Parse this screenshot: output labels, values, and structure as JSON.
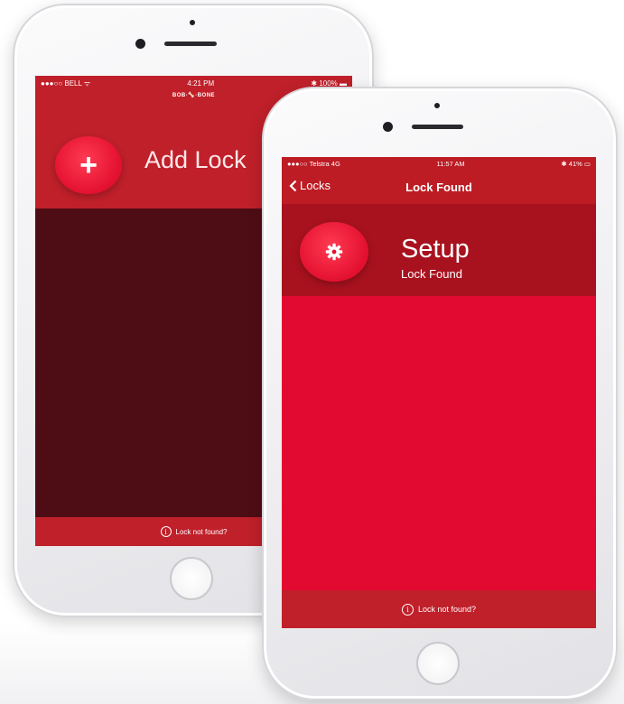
{
  "back_phone": {
    "status": {
      "carrier": "●●●○○ BELL ᯤ",
      "time": "4:21 PM",
      "battery": "✱ 100% ▬"
    },
    "brand_logo": "BOB·🦴·BONE",
    "add_lock": {
      "icon": "+",
      "label": "Add Lock"
    },
    "footer": {
      "icon": "i",
      "text": "Lock not found?"
    }
  },
  "front_phone": {
    "status": {
      "carrier": "●●●○○ Telstra  4G",
      "time": "11:57 AM",
      "battery": "✱ 41% ▭"
    },
    "nav": {
      "back_label": "Locks",
      "title": "Lock Found"
    },
    "setup": {
      "icon": "gear-icon",
      "title": "Setup",
      "subtitle": "Lock Found"
    },
    "footer": {
      "icon": "i",
      "text": "Lock not found?"
    }
  },
  "colors": {
    "header_red": "#c0202a",
    "accent_red": "#e30a32",
    "dark_maroon": "#4e0d14",
    "button_red": "#ff3a52"
  }
}
